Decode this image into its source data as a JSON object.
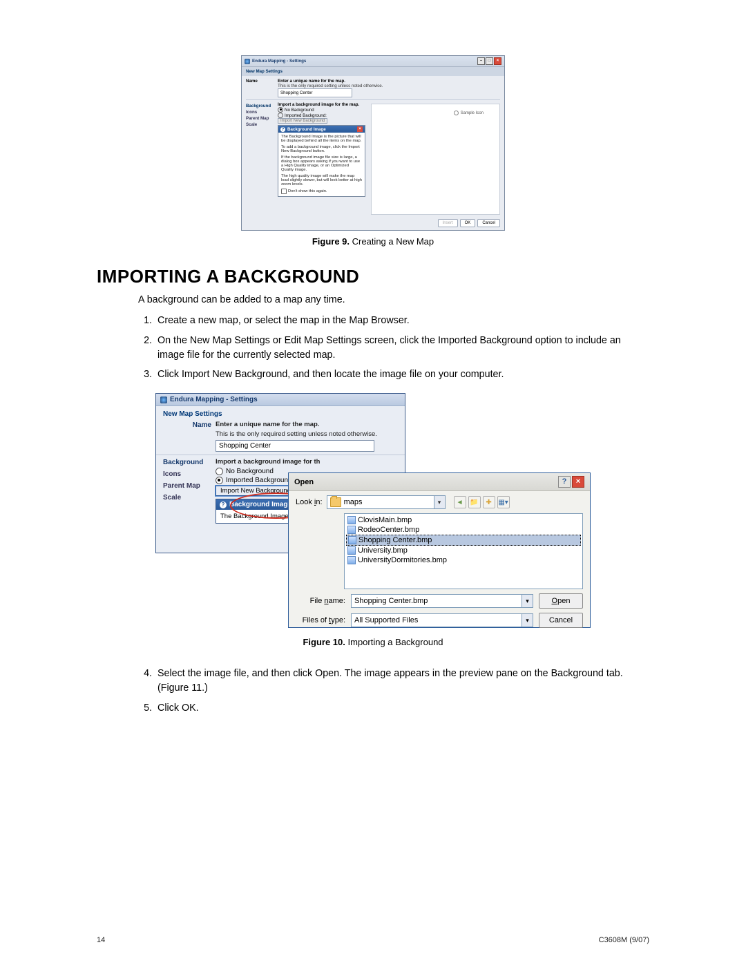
{
  "fig9": {
    "window_title": "Endura Mapping - Settings",
    "section": "New Map Settings",
    "name_label": "Name",
    "name_bold": "Enter a unique name for the map.",
    "name_sub": "This is the only required setting unless noted otherwise.",
    "name_value": "Shopping Center",
    "tabs": {
      "bg": "Background",
      "icons": "Icons",
      "parent": "Parent Map",
      "scale": "Scale"
    },
    "bg_bold": "Import a background image for the map.",
    "radio_no": "No Background",
    "radio_imp": "Imported Background:",
    "import_btn": "Import New Background",
    "help_title": "Background Image",
    "help_p1": "The Background Image is the picture that will be displayed behind all the items on the map.",
    "help_p2": "To add a background image, click the Import New Background button.",
    "help_p3": "If the background image file size is large, a dialog box appears asking if you want to use a High Quality image, or an Optimized Quality image.",
    "help_p4": "The high quality image will make the map load slightly slower, but will look better at high zoom levels.",
    "help_cb": "Don't show this again.",
    "sample": "Sample Icon",
    "btn_insert": "Insert",
    "btn_ok": "OK",
    "btn_cancel": "Cancel"
  },
  "captions": {
    "fig9_b": "Figure 9.",
    "fig9_t": "  Creating a New Map",
    "fig10_b": "Figure 10.",
    "fig10_t": "  Importing a Background"
  },
  "heading": "IMPORTING A BACKGROUND",
  "intro": "A background can be added to a map any time.",
  "steps": {
    "s1": "Create a new map, or select the map in the Map Browser.",
    "s2": "On the New Map Settings or Edit Map Settings screen, click the Imported Background option to include an image file for the currently selected map.",
    "s3": "Click Import New Background, and then locate the image file on your computer.",
    "s4": "Select the image file, and then click Open. The image appears in the preview pane on the Background tab. (Figure 11.)",
    "s5": "Click OK."
  },
  "fig10": {
    "window_title": "Endura Mapping - Settings",
    "section": "New Map Settings",
    "name_label": "Name",
    "name_bold": "Enter a unique name for the map.",
    "name_sub": "This is the only required setting unless noted otherwise.",
    "name_value": "Shopping Center",
    "tabs": {
      "bg": "Background",
      "icons": "Icons",
      "parent": "Parent Map",
      "scale": "Scale"
    },
    "bg_bold": "Import a background image for th",
    "radio_no": "No Background",
    "radio_imp": "Imported Background:",
    "import_btn": "Import New Background",
    "help_title": "Background Image",
    "help_line": "The Background Image is the p"
  },
  "open": {
    "title": "Open",
    "lookin_label": "Look in:",
    "lookin_value": "maps",
    "files": [
      "ClovisMain.bmp",
      "RodeoCenter.bmp",
      "Shopping Center.bmp",
      "University.bmp",
      "UniversityDormitories.bmp"
    ],
    "selected": "Shopping Center.bmp",
    "filename_label": "File name:",
    "filename_value": "Shopping Center.bmp",
    "filetype_label": "Files of type:",
    "filetype_value": "All Supported Files",
    "open_btn": "Open",
    "cancel_btn": "Cancel"
  },
  "footer": {
    "page": "14",
    "doc": "C3608M (9/07)"
  }
}
